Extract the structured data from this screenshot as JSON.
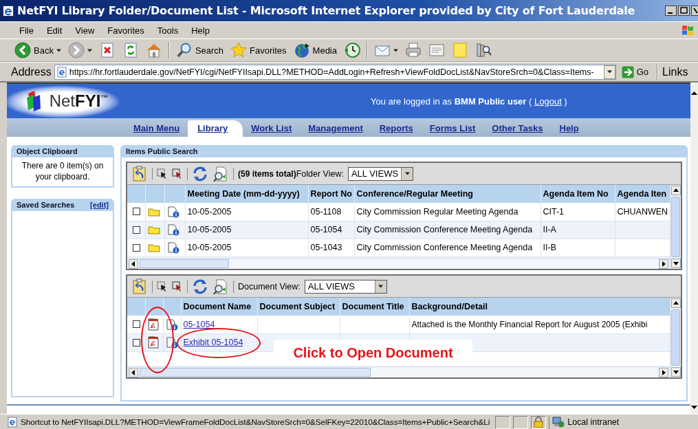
{
  "window": {
    "title": "NetFYI Library Folder/Document List - Microsoft Internet Explorer provided by City of Fort Lauderdale"
  },
  "menu": [
    "File",
    "Edit",
    "View",
    "Favorites",
    "Tools",
    "Help"
  ],
  "toolbar": [
    {
      "kind": "back",
      "label": "Back"
    },
    {
      "kind": "forward"
    },
    {
      "kind": "stop"
    },
    {
      "kind": "refresh"
    },
    {
      "kind": "home"
    },
    {
      "kind": "search",
      "label": "Search"
    },
    {
      "kind": "favorites",
      "label": "Favorites"
    },
    {
      "kind": "media",
      "label": "Media"
    },
    {
      "kind": "history"
    },
    {
      "kind": "mail"
    },
    {
      "kind": "print"
    },
    {
      "kind": "edit"
    },
    {
      "kind": "note"
    },
    {
      "kind": "research"
    }
  ],
  "address": {
    "label": "Address",
    "value": "https://hr.fortlauderdale.gov/NetFYI/cgi/NetFYIIsapi.DLL?METHOD=AddLogin+Refresh+ViewFoldDocList&NavStoreSrch=0&Class=Items-",
    "go": "Go",
    "links": "Links"
  },
  "header": {
    "logo": "Net**FYI**$^{™}$",
    "login": "You are logged in as **BMM Public user** ( ",
    "logout": "Logout",
    "login_end": " )"
  },
  "nav": [
    {
      "label": "Main Menu",
      "selected": false
    },
    {
      "label": "Library",
      "selected": true
    },
    {
      "label": "Work List",
      "selected": false
    },
    {
      "label": "Management",
      "selected": false
    },
    {
      "label": "Reports",
      "selected": false
    },
    {
      "label": "Forms List",
      "selected": false
    },
    {
      "label": "Other Tasks",
      "selected": false
    },
    {
      "label": "Help",
      "selected": false
    }
  ],
  "clipboard": {
    "title": "Object Clipboard",
    "text": "There are 0 item(s) on your clipboard."
  },
  "saved_searches": {
    "title": "Saved Searches",
    "edit": "[edit]"
  },
  "items": {
    "title": "Items Public Search",
    "total": "(59 items total)",
    "view_label": "Folder View:",
    "view_value": "ALL VIEWS",
    "columns": [
      "Meeting Date (mm-dd-yyyy)",
      "Report No",
      "Conference/Regular Meeting",
      "Agenda Item No",
      "Agenda Iten"
    ],
    "rows": [
      {
        "checked": false,
        "cells": [
          "10-05-2005",
          "05-1108",
          "City Commission Regular Meeting Agenda",
          "CIT-1",
          "CHUANWEN"
        ]
      },
      {
        "checked": false,
        "cells": [
          "10-05-2005",
          "05-1054",
          "City Commission Conference Meeting Agenda",
          "II-A"
        ]
      },
      {
        "checked": false,
        "cells": [
          "10-05-2005",
          "05-1043",
          "City Commission Conference Meeting Agenda",
          "II-B"
        ]
      }
    ]
  },
  "documents": {
    "view_label": "Document View:",
    "view_value": "ALL VIEWS",
    "columns": [
      "Document Name",
      "Document Subject",
      "Document Title",
      "Background/Detail"
    ],
    "rows": [
      {
        "checked": false,
        "name": "05-1054",
        "detail": "Attached is the Monthly Financial Report for August 2005 (Exhibi"
      },
      {
        "checked": false,
        "name": "Exhibit 05-1054"
      }
    ]
  },
  "annotation": {
    "text": "Click to Open Document"
  },
  "status_bar": {
    "text": "Shortcut to NetFYIIsapi.DLL?METHOD=ViewFrameFoldDocList&NavStoreSrch=0&SelFKey=22010&Class=Items+Public+Search&Li",
    "zone": "Local intranet"
  }
}
